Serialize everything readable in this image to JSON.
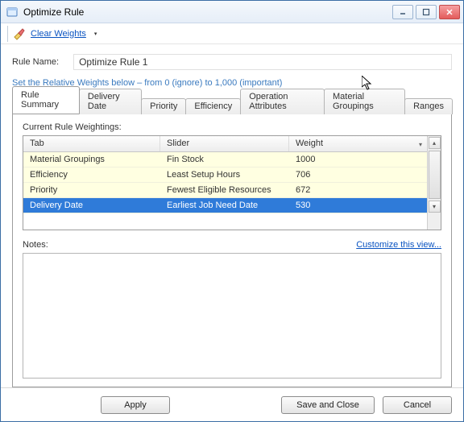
{
  "window": {
    "title": "Optimize Rule"
  },
  "toolbar": {
    "clear_weights_label": "Clear Weights"
  },
  "rule_name": {
    "label": "Rule Name:",
    "value": "Optimize Rule 1"
  },
  "help_text": "Set the Relative Weights below – from 0 (ignore) to 1,000 (important)",
  "tabs": [
    {
      "label": "Rule Summary",
      "active": true
    },
    {
      "label": "Delivery Date"
    },
    {
      "label": "Priority"
    },
    {
      "label": "Efficiency"
    },
    {
      "label": "Operation Attributes"
    },
    {
      "label": "Material Groupings"
    },
    {
      "label": "Ranges"
    }
  ],
  "grid": {
    "title": "Current Rule Weightings:",
    "columns": {
      "tab": "Tab",
      "slider": "Slider",
      "weight": "Weight"
    },
    "rows": [
      {
        "tab": "Material Groupings",
        "slider": "Fin Stock",
        "weight": "1000"
      },
      {
        "tab": "Efficiency",
        "slider": "Least Setup Hours",
        "weight": "706"
      },
      {
        "tab": "Priority",
        "slider": "Fewest Eligible Resources",
        "weight": "672"
      },
      {
        "tab": "Delivery Date",
        "slider": "Earliest Job Need Date",
        "weight": "530",
        "selected": true
      }
    ]
  },
  "notes": {
    "label": "Notes:"
  },
  "links": {
    "customize": "Customize this view..."
  },
  "buttons": {
    "apply": "Apply",
    "save_close": "Save and Close",
    "cancel": "Cancel"
  }
}
